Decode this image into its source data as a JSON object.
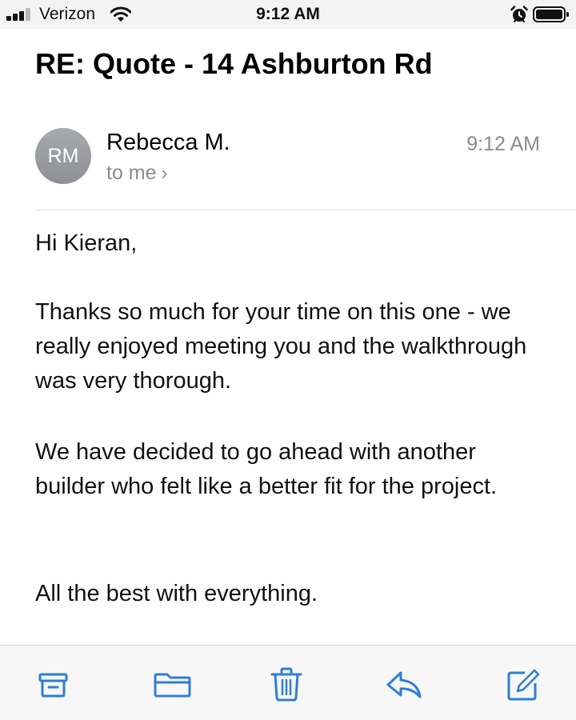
{
  "status_bar": {
    "carrier": "Verizon",
    "time": "9:12 AM",
    "signal_bars_filled": 3,
    "signal_bars_total": 4,
    "icons": [
      "signal-icon",
      "wifi-icon",
      "alarm-icon",
      "battery-icon"
    ]
  },
  "email": {
    "subject": "RE: Quote - 14 Ashburton Rd",
    "sender": {
      "initials": "RM",
      "name": "Rebecca M.",
      "recipient": "to me",
      "time": "9:12 AM"
    },
    "body": {
      "greeting": "Hi Kieran,",
      "paragraph_1": "Thanks so much for your time on this one - we really enjoyed meeting you and the walkthrough was very thorough.",
      "paragraph_2": "We have decided to go ahead with another builder who felt like a better fit for the project.",
      "closing": "All the best with everything."
    }
  },
  "toolbar": {
    "items": [
      {
        "icon": "archive-icon"
      },
      {
        "icon": "folder-icon"
      },
      {
        "icon": "trash-icon"
      },
      {
        "icon": "reply-icon"
      },
      {
        "icon": "compose-icon"
      }
    ]
  },
  "colors": {
    "accent": "#2f7dd6",
    "secondary_text": "#8b8b8f",
    "avatar": "#9a9ca1"
  }
}
